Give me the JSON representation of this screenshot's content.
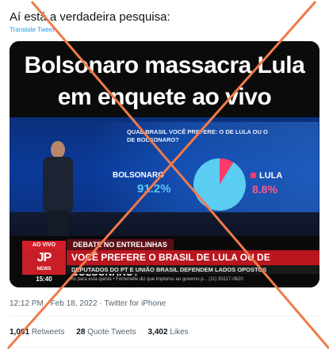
{
  "tweet": {
    "text": "Aí está a verdadeira pesquisa:",
    "translate_label": "Translate Tweet"
  },
  "media": {
    "headline_line1": "Bolsonaro massacra Lula",
    "headline_line2": "em enquete ao vivo",
    "poll_question": "QUAL BRASIL VOCÊ PREFERE: O DE LULA OU O DE BOLSONARO?",
    "bolsonaro_label": "BOLSONARO",
    "bolsonaro_value": "91.2%",
    "lula_label": "LULA",
    "lula_value": "8.8%",
    "pie_slices": [
      {
        "label": "BOLSONARO",
        "percent": 91.2,
        "color": "#5ccdf2"
      },
      {
        "label": "LULA",
        "percent": 8.8,
        "color": "#ff3b6b"
      }
    ],
    "live_tag": "AO VIVO",
    "segment_tag": "DEBATE NO ENTRELINHAS",
    "channel_logo": "JP",
    "channel_sub": "NEWS",
    "main_question": "VOCÊ PREFERE O BRASIL DE LULA OU DE BOLSONARO?",
    "sub_line": "DEPUTADOS DO PT E UNIÃO BRASIL DEFENDEM LADOS OPOSTOS",
    "clock": "15:40",
    "ticker": "llo para esta quinta • Fontenelle diz que implorou ao governo p... (11) 93117-0620"
  },
  "meta": {
    "timestamp": "12:12 PM · Feb 18, 2022 · Twitter for iPhone"
  },
  "stats": {
    "retweets_count": "1,061",
    "retweets_label": "Retweets",
    "quote_count": "28",
    "quote_label": "Quote Tweets",
    "likes_count": "3,402",
    "likes_label": "Likes"
  },
  "colors": {
    "cross_stroke": "#f07a4a",
    "link": "#1d9bf0"
  }
}
